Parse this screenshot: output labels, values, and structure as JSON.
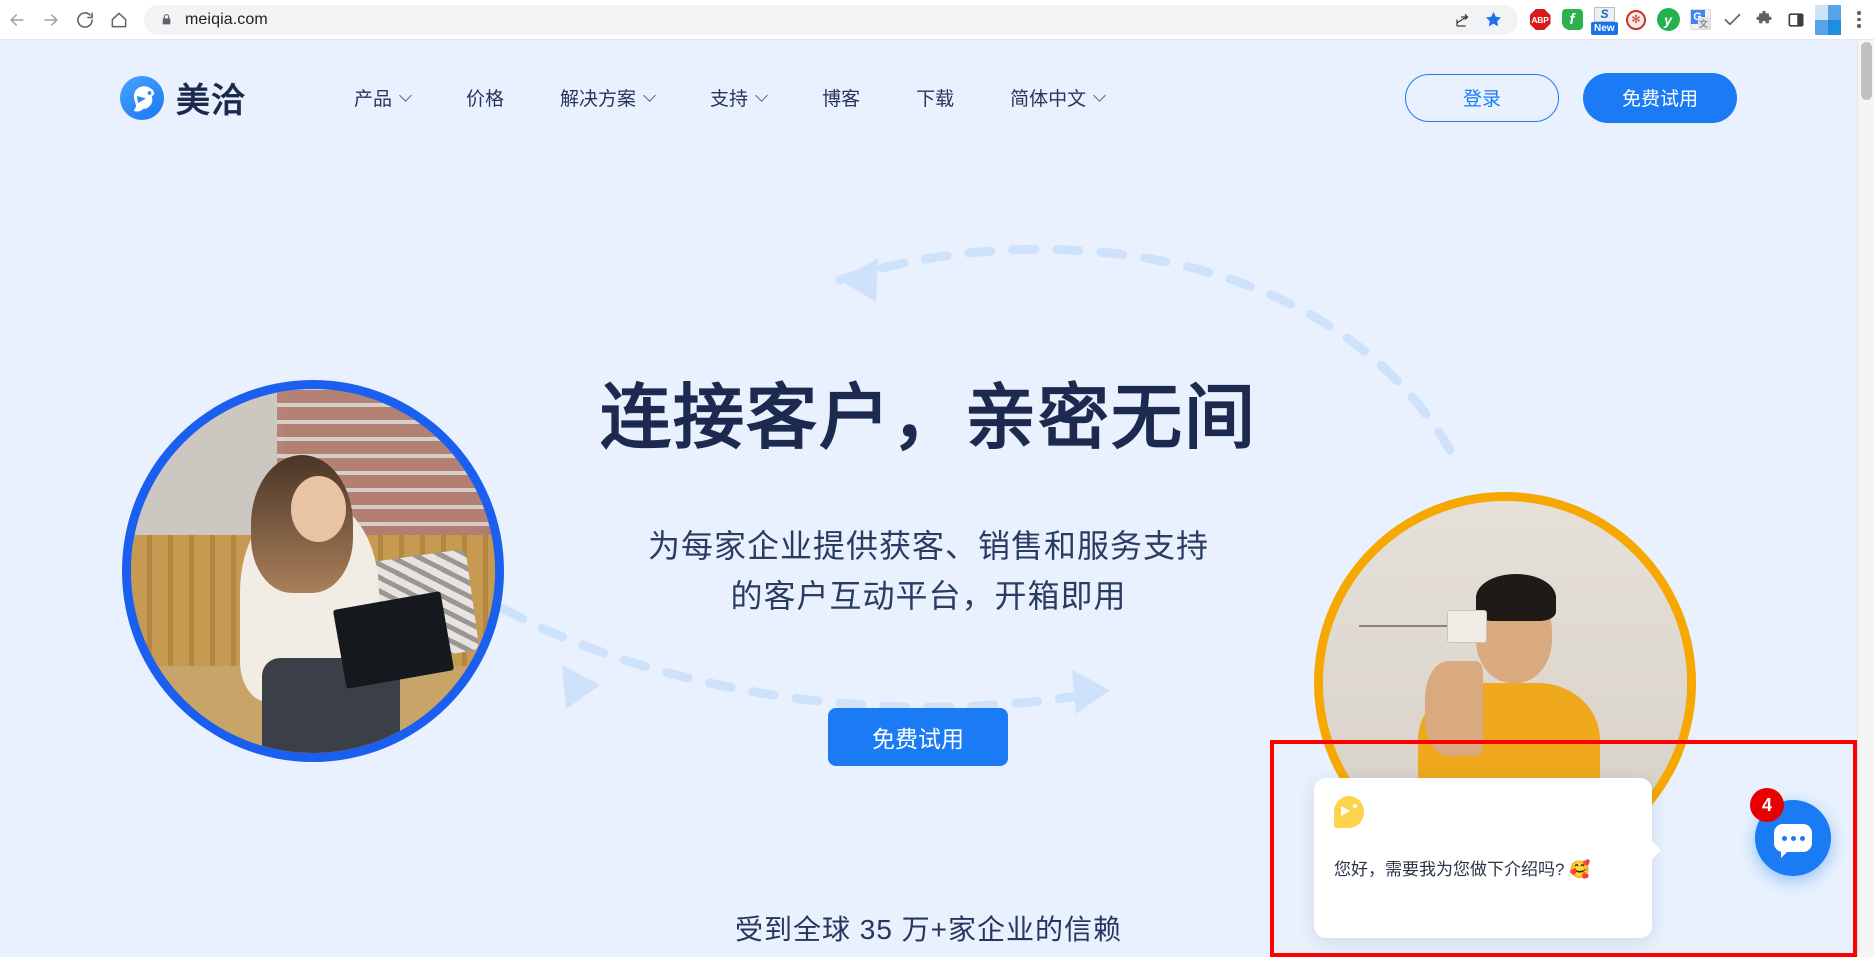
{
  "browser": {
    "url": "meiqia.com",
    "nav": {
      "back": "back-arrow",
      "forward": "forward-arrow",
      "reload": "reload",
      "home": "home"
    },
    "omnibox_actions": [
      {
        "name": "share-icon",
        "label": "share"
      },
      {
        "name": "bookmark-star-icon",
        "label": "bookmark"
      }
    ],
    "extensions": [
      {
        "name": "adblock-plus-icon",
        "label": "ABP"
      },
      {
        "name": "feedly-icon",
        "label": "f"
      },
      {
        "name": "snipaste-icon",
        "label": "S",
        "badge": "New"
      },
      {
        "name": "extension-red-icon",
        "label": "*"
      },
      {
        "name": "youdao-icon",
        "label": "y"
      },
      {
        "name": "google-translate-icon",
        "label": "G",
        "sub": "文"
      },
      {
        "name": "checkmark-icon",
        "label": "check"
      },
      {
        "name": "puzzle-extensions-icon",
        "label": "puzzle"
      },
      {
        "name": "side-panel-icon",
        "label": "panel"
      },
      {
        "name": "profile-avatar-icon",
        "label": "profile"
      },
      {
        "name": "chrome-menu-icon",
        "label": "menu"
      }
    ]
  },
  "site": {
    "brand": {
      "name": "美洽",
      "mark": "parrot-logo"
    },
    "nav_items": [
      {
        "label": "产品",
        "has_dropdown": true
      },
      {
        "label": "价格",
        "has_dropdown": false
      },
      {
        "label": "解决方案",
        "has_dropdown": true
      },
      {
        "label": "支持",
        "has_dropdown": true
      },
      {
        "label": "博客",
        "has_dropdown": false
      },
      {
        "label": "下载",
        "has_dropdown": false
      },
      {
        "label": "简体中文",
        "has_dropdown": true
      }
    ],
    "login_label": "登录",
    "trial_label": "免费试用"
  },
  "hero": {
    "title": "连接客户，亲密无间",
    "subtitle_line1": "为每家企业提供获客、销售和服务支持",
    "subtitle_line2": "的客户互动平台，开箱即用",
    "cta_label": "免费试用",
    "trust_text": "受到全球 35 万+家企业的信赖",
    "photo_left_alt": "woman-working-on-laptop",
    "photo_right_alt": "man-with-tin-can-phone"
  },
  "chat_widget": {
    "message": "您好，需要我为您做下介绍吗? 🥰",
    "unread_badge": "4",
    "avatar": "parrot-avatar",
    "launcher": "chat-bubble-icon"
  },
  "colors": {
    "accent_blue": "#1a7bf5",
    "page_bg": "#e8f1fd",
    "title_navy": "#1b2a4e",
    "ring_orange": "#f7a800",
    "badge_red": "#e60000",
    "highlight_red": "#ff0000"
  }
}
